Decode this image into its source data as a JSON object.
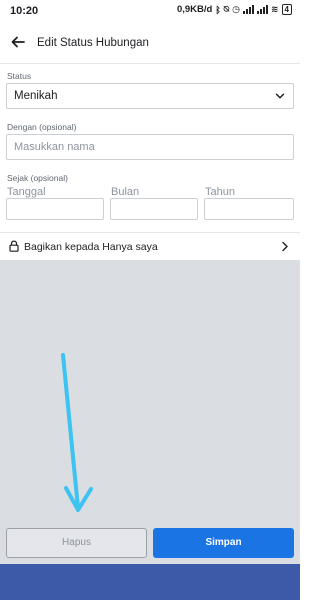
{
  "status_bar": {
    "time": "10:20",
    "speed": "0,9KB/d",
    "battery": "4"
  },
  "header": {
    "title": "Edit Status Hubungan"
  },
  "form": {
    "status_label": "Status",
    "status_value": "Menikah",
    "partner_label": "Dengan (opsional)",
    "partner_placeholder": "Masukkan nama",
    "since_label": "Sejak (opsional)",
    "day_placeholder": "Tanggal",
    "month_placeholder": "Bulan",
    "year_placeholder": "Tahun"
  },
  "privacy": {
    "label": "Bagikan kepada Hanya saya"
  },
  "buttons": {
    "delete_label": "Hapus",
    "save_label": "Simpan"
  },
  "colors": {
    "accent": "#1b74e4",
    "annotation_arrow": "#3cc3f2",
    "bottom_bar": "#3c5aa8",
    "background_gray": "#dadde1"
  }
}
